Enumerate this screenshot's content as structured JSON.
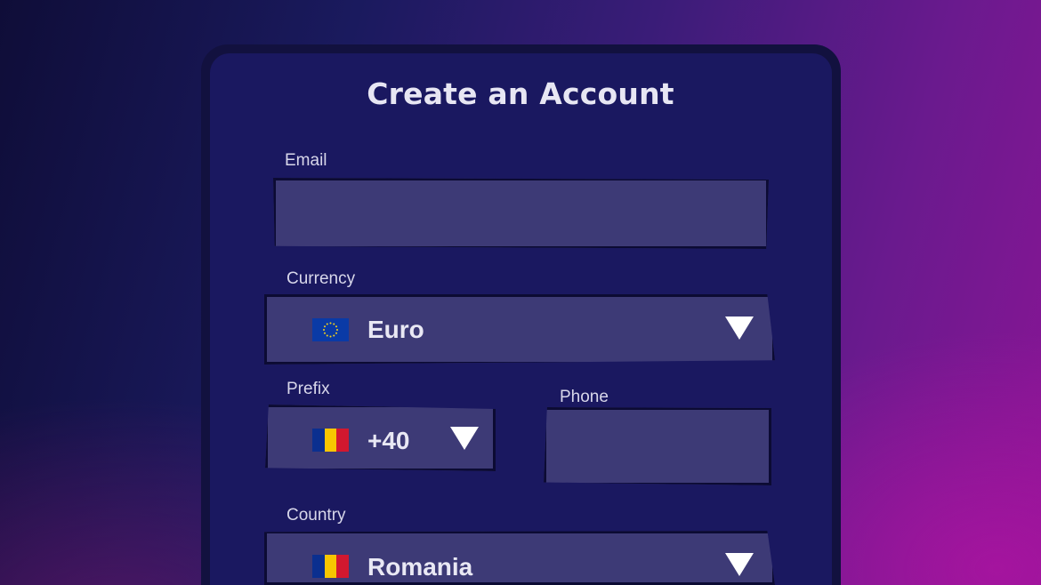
{
  "form": {
    "title": "Create an Account",
    "email": {
      "label": "Email",
      "value": ""
    },
    "currency": {
      "label": "Currency",
      "value": "Euro",
      "flag_icon": "eu-flag-icon"
    },
    "prefix": {
      "label": "Prefix",
      "value": "+40",
      "flag_icon": "romania-flag-icon"
    },
    "phone": {
      "label": "Phone",
      "value": ""
    },
    "country": {
      "label": "Country",
      "value": "Romania",
      "flag_icon": "romania-flag-icon"
    }
  },
  "colors": {
    "card_background": "#1a1860",
    "field_background": "#3d3a76",
    "romania_flag": [
      "#0b2f8f",
      "#f7c600",
      "#d2182f"
    ],
    "eu_flag": "#0a3aa6"
  }
}
